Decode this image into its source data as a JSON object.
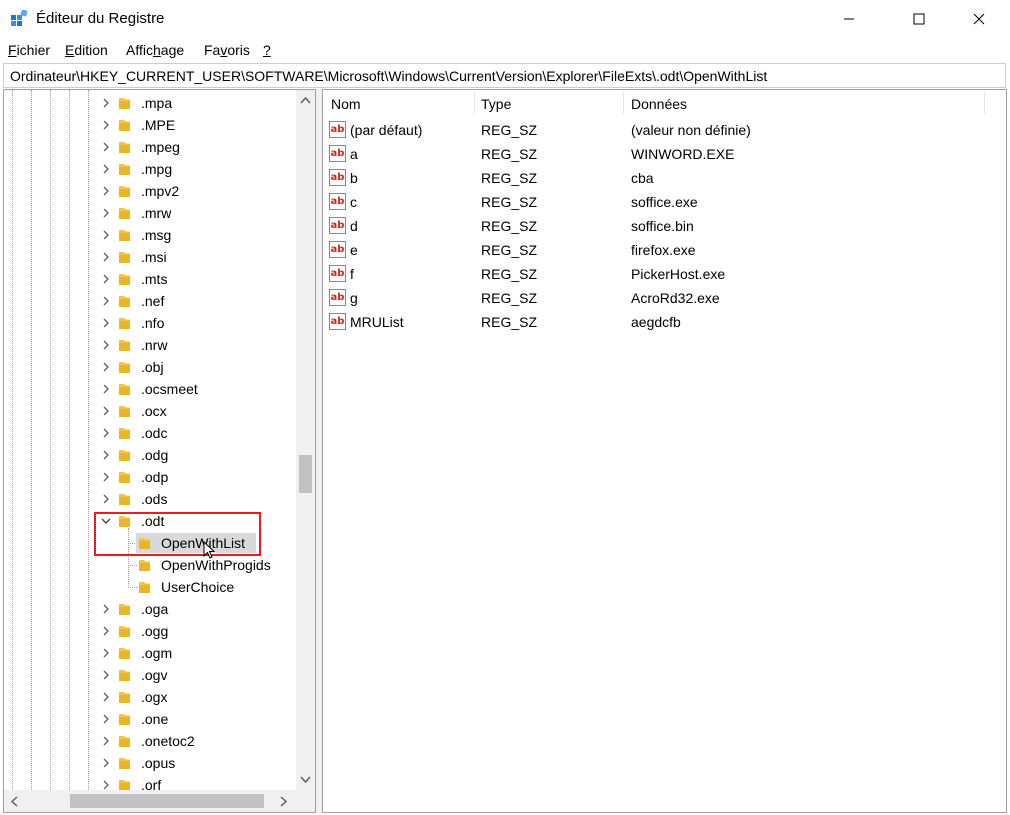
{
  "window": {
    "title": "Éditeur du Registre",
    "icon": "registry-editor-icon"
  },
  "menu": {
    "items": [
      {
        "label": "Fichier"
      },
      {
        "label": "Edition"
      },
      {
        "label": "Affichage"
      },
      {
        "label": "Favoris"
      },
      {
        "label": "?"
      }
    ]
  },
  "address": {
    "path": "Ordinateur\\HKEY_CURRENT_USER\\SOFTWARE\\Microsoft\\Windows\\CurrentVersion\\Explorer\\FileExts\\.odt\\OpenWithList"
  },
  "tree": {
    "nodes": [
      {
        "label": ".mpa",
        "state": "collapsed"
      },
      {
        "label": ".MPE",
        "state": "collapsed"
      },
      {
        "label": ".mpeg",
        "state": "collapsed"
      },
      {
        "label": ".mpg",
        "state": "collapsed"
      },
      {
        "label": ".mpv2",
        "state": "collapsed"
      },
      {
        "label": ".mrw",
        "state": "collapsed"
      },
      {
        "label": ".msg",
        "state": "collapsed"
      },
      {
        "label": ".msi",
        "state": "collapsed"
      },
      {
        "label": ".mts",
        "state": "collapsed"
      },
      {
        "label": ".nef",
        "state": "collapsed"
      },
      {
        "label": ".nfo",
        "state": "collapsed"
      },
      {
        "label": ".nrw",
        "state": "collapsed"
      },
      {
        "label": ".obj",
        "state": "collapsed"
      },
      {
        "label": ".ocsmeet",
        "state": "collapsed"
      },
      {
        "label": ".ocx",
        "state": "collapsed"
      },
      {
        "label": ".odc",
        "state": "collapsed"
      },
      {
        "label": ".odg",
        "state": "collapsed"
      },
      {
        "label": ".odp",
        "state": "collapsed"
      },
      {
        "label": ".ods",
        "state": "collapsed"
      },
      {
        "label": ".odt",
        "state": "expanded"
      },
      {
        "label": "OpenWithList",
        "state": "child",
        "selected": true
      },
      {
        "label": "OpenWithProgids",
        "state": "child"
      },
      {
        "label": "UserChoice",
        "state": "child"
      },
      {
        "label": ".oga",
        "state": "collapsed"
      },
      {
        "label": ".ogg",
        "state": "collapsed"
      },
      {
        "label": ".ogm",
        "state": "collapsed"
      },
      {
        "label": ".ogv",
        "state": "collapsed"
      },
      {
        "label": ".ogx",
        "state": "collapsed"
      },
      {
        "label": ".one",
        "state": "collapsed"
      },
      {
        "label": ".onetoc2",
        "state": "collapsed"
      },
      {
        "label": ".opus",
        "state": "collapsed"
      },
      {
        "label": ".orf",
        "state": "collapsed"
      }
    ]
  },
  "list": {
    "columns": [
      {
        "label": "Nom"
      },
      {
        "label": "Type"
      },
      {
        "label": "Données"
      }
    ],
    "rows": [
      {
        "name": "(par défaut)",
        "type": "REG_SZ",
        "data": "(valeur non définie)"
      },
      {
        "name": "a",
        "type": "REG_SZ",
        "data": "WINWORD.EXE"
      },
      {
        "name": "b",
        "type": "REG_SZ",
        "data": "cba"
      },
      {
        "name": "c",
        "type": "REG_SZ",
        "data": "soffice.exe"
      },
      {
        "name": "d",
        "type": "REG_SZ",
        "data": "soffice.bin"
      },
      {
        "name": "e",
        "type": "REG_SZ",
        "data": "firefox.exe"
      },
      {
        "name": "f",
        "type": "REG_SZ",
        "data": "PickerHost.exe"
      },
      {
        "name": "g",
        "type": "REG_SZ",
        "data": "AcroRd32.exe"
      },
      {
        "name": "MRUList",
        "type": "REG_SZ",
        "data": "aegdcfb"
      }
    ],
    "value_icon_text": "ab"
  },
  "colors": {
    "highlight": "#e31e24",
    "folder": "#f3c63f",
    "selection": "#d9d9d9"
  }
}
